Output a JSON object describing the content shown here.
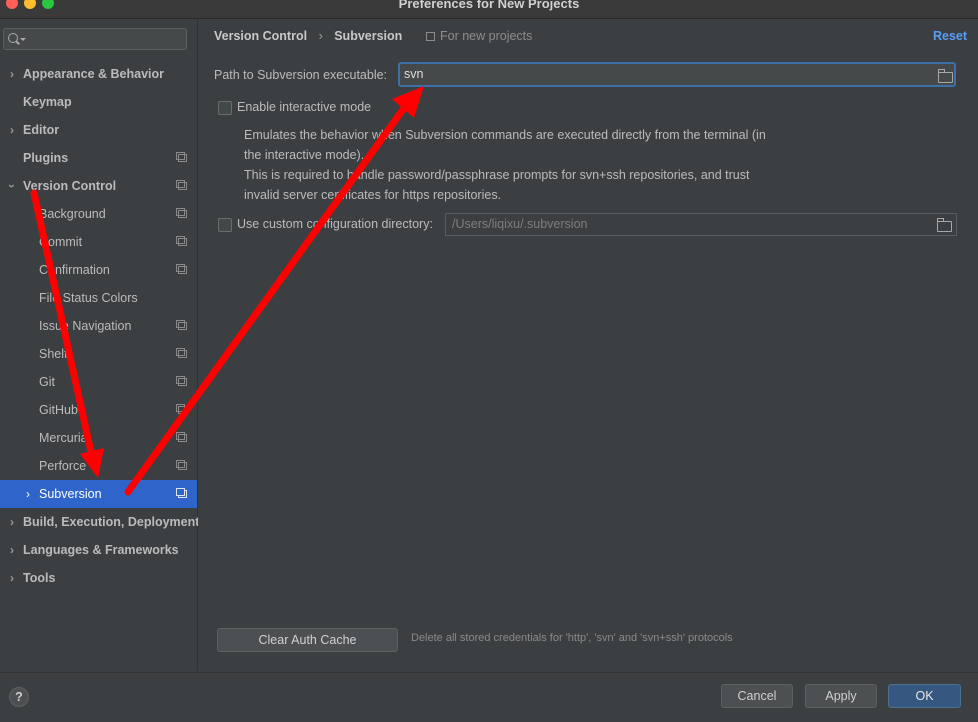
{
  "window": {
    "title": "Preferences for New Projects"
  },
  "search": {
    "placeholder": ""
  },
  "sidebar": {
    "items": [
      {
        "label": "Appearance & Behavior",
        "name": "sidebar-item-appearance-behavior"
      },
      {
        "label": "Keymap",
        "name": "sidebar-item-keymap"
      },
      {
        "label": "Editor",
        "name": "sidebar-item-editor"
      },
      {
        "label": "Plugins",
        "name": "sidebar-item-plugins"
      },
      {
        "label": "Version Control",
        "name": "sidebar-item-version-control"
      },
      {
        "label": "Background",
        "name": "sidebar-item-background"
      },
      {
        "label": "Commit",
        "name": "sidebar-item-commit"
      },
      {
        "label": "Confirmation",
        "name": "sidebar-item-confirmation"
      },
      {
        "label": "File Status Colors",
        "name": "sidebar-item-file-status-colors"
      },
      {
        "label": "Issue Navigation",
        "name": "sidebar-item-issue-navigation"
      },
      {
        "label": "Shelf",
        "name": "sidebar-item-shelf"
      },
      {
        "label": "Git",
        "name": "sidebar-item-git"
      },
      {
        "label": "GitHub",
        "name": "sidebar-item-github"
      },
      {
        "label": "Mercurial",
        "name": "sidebar-item-mercurial"
      },
      {
        "label": "Perforce",
        "name": "sidebar-item-perforce"
      },
      {
        "label": "Subversion",
        "name": "sidebar-item-subversion"
      },
      {
        "label": "Build, Execution, Deployment",
        "name": "sidebar-item-build-execution-deployment"
      },
      {
        "label": "Languages & Frameworks",
        "name": "sidebar-item-languages-frameworks"
      },
      {
        "label": "Tools",
        "name": "sidebar-item-tools"
      }
    ]
  },
  "header": {
    "breadcrumb_parent": "Version Control",
    "breadcrumb_current": "Subversion",
    "scope_label": "For new projects",
    "reset_label": "Reset"
  },
  "settings": {
    "path_label": "Path to Subversion executable:",
    "path_value": "svn",
    "interactive_mode_label": "Enable interactive mode",
    "interactive_mode_checked": false,
    "interactive_desc_line1": "Emulates the behavior when Subversion commands are executed directly from the terminal (in",
    "interactive_desc_line2": "the interactive mode).",
    "interactive_desc_line3": "This is required to handle password/passphrase prompts for svn+ssh repositories, and trust",
    "interactive_desc_line4": "invalid server certificates for https repositories.",
    "custom_config_label": "Use custom configuration directory:",
    "custom_config_checked": false,
    "custom_config_value": "/Users/liqixu/.subversion",
    "clear_cache_label": "Clear Auth Cache",
    "clear_cache_hint": "Delete all stored credentials for 'http', 'svn' and 'svn+ssh' protocols"
  },
  "footer": {
    "help_label": "?",
    "cancel_label": "Cancel",
    "apply_label": "Apply",
    "ok_label": "OK"
  },
  "colors": {
    "background": "#3c3f41",
    "selection": "#2f65ca",
    "accent_link": "#589df6",
    "primary_button": "#365880",
    "annotation_arrow": "#ff0000"
  },
  "icons": {
    "search": "search-icon",
    "folder": "folder-icon",
    "project_scope": "project-settings-icon",
    "annotation": "red-arrow-annotation"
  }
}
